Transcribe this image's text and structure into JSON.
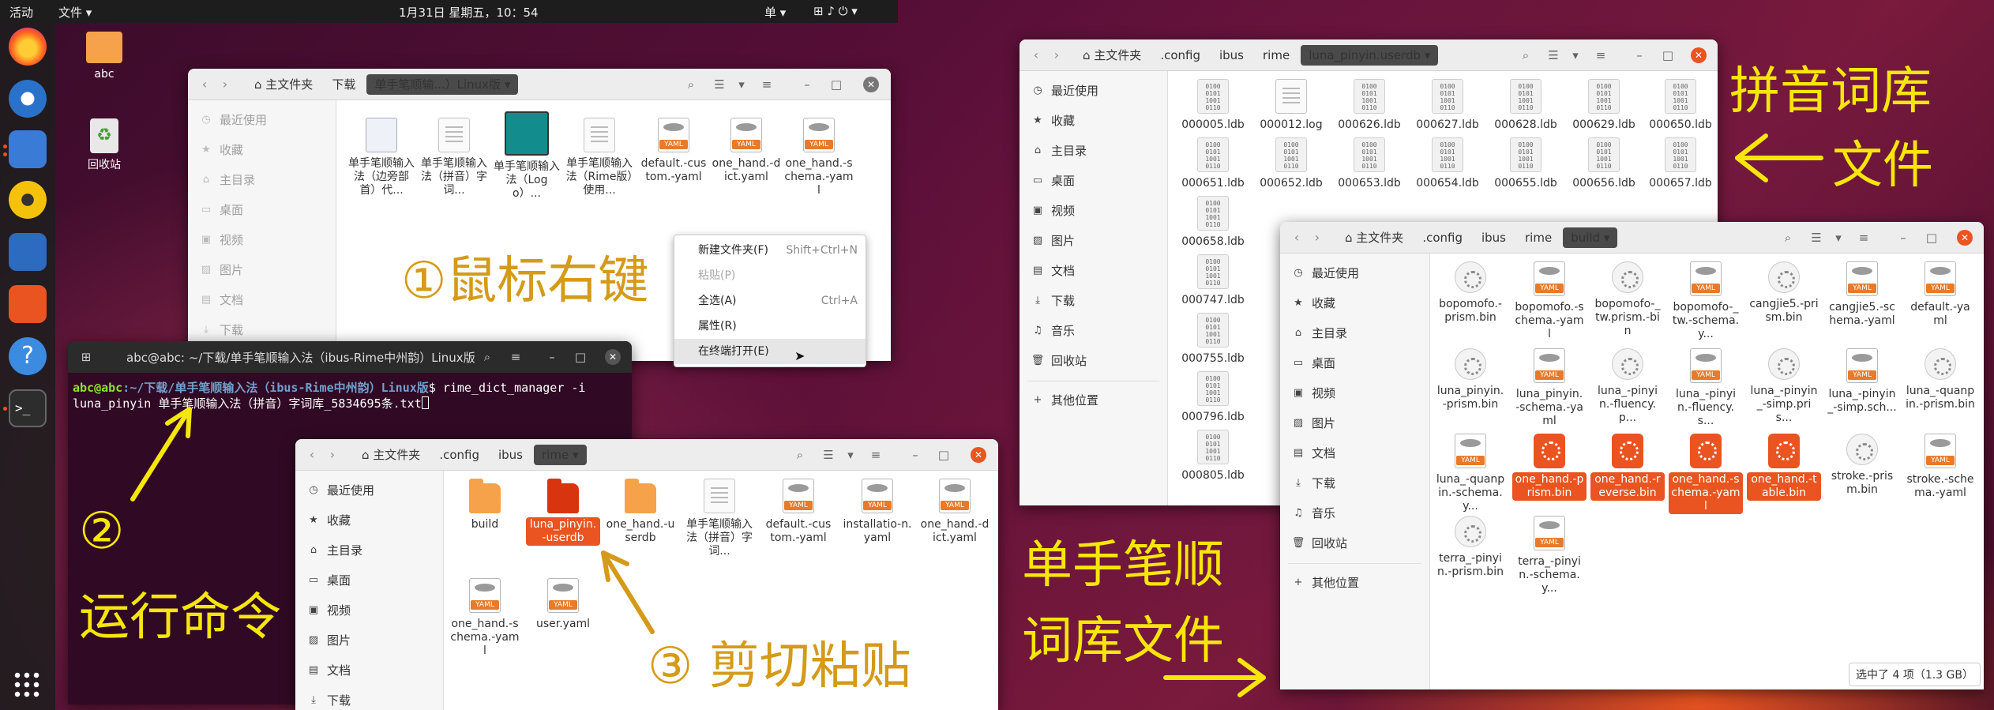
{
  "topbar": {
    "activities": "活动",
    "app_menu": "文件",
    "clock": "1月31日 星期五，10：54",
    "input_method": "单",
    "tray": "⊞ ♪ ⏻ ▾"
  },
  "desktop": {
    "home_label": "abc",
    "trash_label": "回收站"
  },
  "win1": {
    "crumbs": [
      "主文件夹",
      "下载",
      "单手笔顺输...）Linux版"
    ],
    "sidebar": [
      "最近使用",
      "收藏",
      "主目录",
      "桌面",
      "视频",
      "图片",
      "文档",
      "下载"
    ],
    "files": [
      "单手笔顺输入法（边旁部首）代...",
      "单手笔顺输入法（拼音）字词...",
      "单手笔顺输入法（Logo）...",
      "单手笔顺输入法（Rime版）使用...",
      "default.-custom.-yaml",
      "one_hand.-dict.yaml",
      "one_hand.-schema.-yaml"
    ]
  },
  "ctxmenu": {
    "items": [
      {
        "label": "新建文件夹(F)",
        "key": "Shift+Ctrl+N"
      },
      {
        "label": "粘贴(P)",
        "key": ""
      },
      {
        "label": "全选(A)",
        "key": "Ctrl+A"
      },
      {
        "label": "属性(R)",
        "key": ""
      },
      {
        "label": "在终端打开(E)",
        "key": ""
      }
    ]
  },
  "terminal": {
    "title": "abc@abc: ~/下载/单手笔顺输入法（ibus-Rime中州韵）Linux版",
    "prompt": "abc@abc",
    "path": ":~/下载/单手笔顺输入法（ibus-Rime中州韵）Linux版",
    "cmd": "$ rime_dict_manager -i",
    "line2": "luna_pinyin 单手笔顺输入法（拼音）字词库_5834695条.txt"
  },
  "win2": {
    "crumbs": [
      "主文件夹",
      ".config",
      "ibus",
      "rime"
    ],
    "sidebar": [
      "最近使用",
      "收藏",
      "主目录",
      "桌面",
      "视频",
      "图片",
      "文档",
      "下载"
    ],
    "files": [
      "build",
      "luna_pinyin.-userdb",
      "one_hand.-userdb",
      "单手笔顺输入法（拼音）字词...",
      "default.-custom.-yaml",
      "installatio-n.yaml",
      "one_hand.-dict.yaml",
      "one_hand.-schema.-yaml",
      "user.yaml"
    ]
  },
  "win3": {
    "crumbs": [
      "主文件夹",
      ".config",
      "ibus",
      "rime",
      "luna_pinyin.userdb"
    ],
    "sidebar": [
      "最近使用",
      "收藏",
      "主目录",
      "桌面",
      "视频",
      "图片",
      "文档",
      "下载",
      "音乐",
      "回收站",
      "其他位置"
    ],
    "files": [
      "000005.ldb",
      "000012.log",
      "000626.ldb",
      "000627.ldb",
      "000628.ldb",
      "000629.ldb",
      "000650.ldb",
      "000651.ldb",
      "000652.ldb",
      "000653.ldb",
      "000654.ldb",
      "000655.ldb",
      "000656.ldb",
      "000657.ldb",
      "000658.ldb",
      "000747.ldb",
      "000755.ldb",
      "000796.ldb",
      "000805.ldb"
    ]
  },
  "win4": {
    "crumbs": [
      "主文件夹",
      ".config",
      "ibus",
      "rime",
      "build"
    ],
    "sidebar": [
      "最近使用",
      "收藏",
      "主目录",
      "桌面",
      "视频",
      "图片",
      "文档",
      "下载",
      "音乐",
      "回收站",
      "其他位置"
    ],
    "files": [
      "bopomofo.-prism.bin",
      "bopomofo.-schema.-yaml",
      "bopomofo-_tw.prism.-bin",
      "bopomofo-_tw.-schema.y...",
      "cangjie5.-prism.bin",
      "cangjie5.-schema.-yaml",
      "default.-yaml",
      "luna_pinyin.-prism.bin",
      "luna_pinyin.-schema.-yaml",
      "luna_-pinyin.-fluency.p...",
      "luna_-pinyin.-fluency.s...",
      "luna_-pinyin_-simp.pris...",
      "luna_-pinyin_-simp.sch...",
      "luna_-quanpin.-prism.bin",
      "luna_-quanpin.-schema.y...",
      "one_hand.-prism.bin",
      "one_hand.-reverse.bin",
      "one_hand.-schema.-yaml",
      "one_hand.-table.bin",
      "stroke.-prism.bin",
      "stroke.-schema.-yaml",
      "terra_-pinyin.-prism.bin",
      "terra_-pinyin.-schema.y..."
    ],
    "status": "选中了 4 项（1.3 GB）"
  },
  "annotations": {
    "step1": "①鼠标右键",
    "step2_num": "②",
    "step2": "运行命令",
    "step3": "③ 剪切粘贴",
    "pinyin_a": "拼音词库",
    "pinyin_b": "文件",
    "onehand_a": "单手笔顺",
    "onehand_b": "词库文件"
  },
  "colors": {
    "accent": "#e95420",
    "gold": "#d59a18",
    "yellow": "#f6e60a",
    "terminal_bg": "#300a24"
  }
}
